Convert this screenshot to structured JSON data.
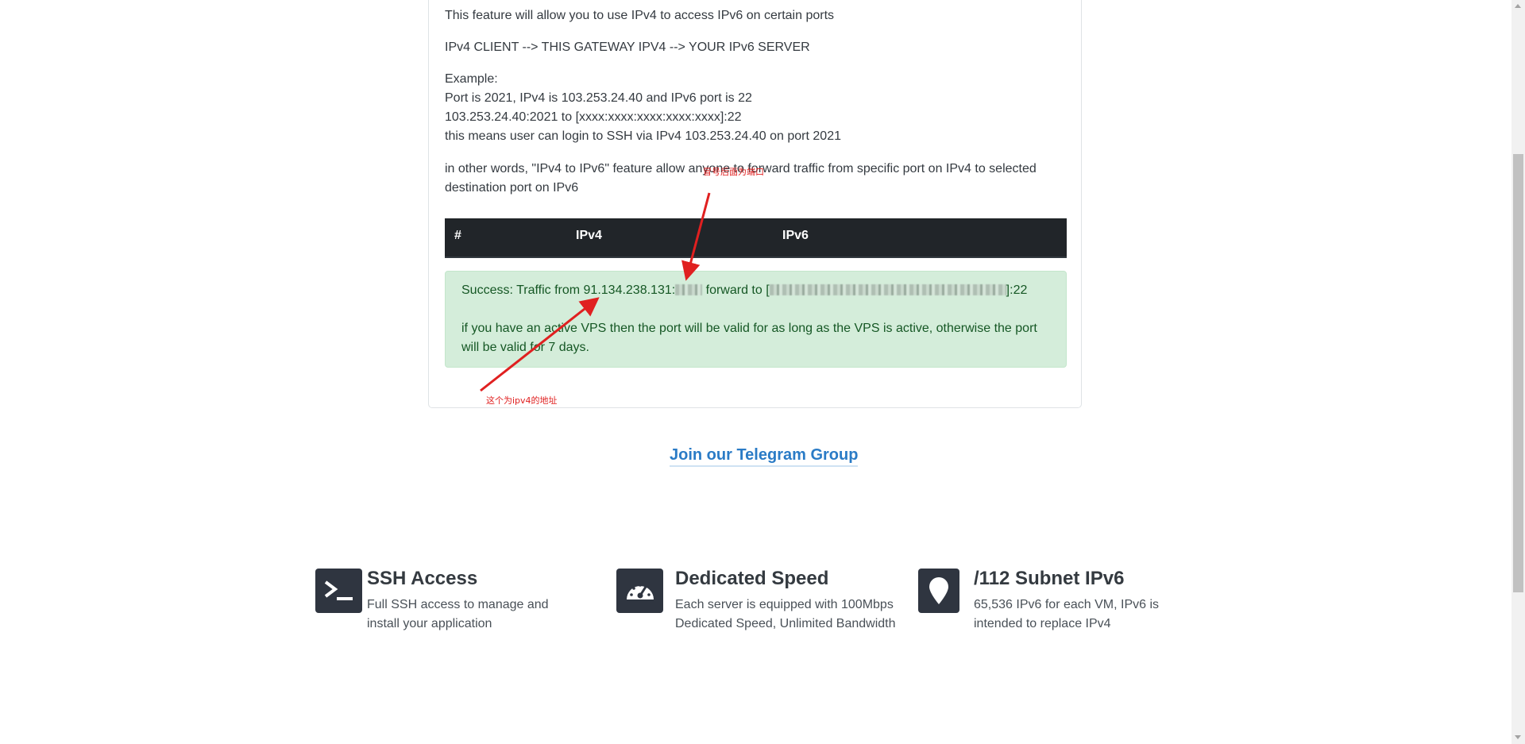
{
  "intro": {
    "line1": "This feature will allow you to use IPv4 to access IPv6 on certain ports",
    "line2": "IPv4 CLIENT --> THIS GATEWAY IPV4 --> YOUR IPv6 SERVER",
    "example_heading": "Example:",
    "example_1": "Port is 2021, IPv4 is 103.253.24.40 and IPv6 port is 22",
    "example_2": "103.253.24.40:2021 to [xxxx:xxxx:xxxx:xxxx:xxxx]:22",
    "example_3": "this means user can login to SSH via IPv4 103.253.24.40 on port 2021",
    "other_words_1": "in other words, \"IPv4 to IPv6\" feature allow anyone to forward traffic from specific port on IPv4 to selected",
    "other_words_2": "destination port on IPv6"
  },
  "table": {
    "col_hash": "#",
    "col_ipv4": "IPv4",
    "col_ipv6": "IPv6"
  },
  "alert": {
    "prefix": "Success: Traffic from 91.134.238.131:",
    "middle": " forward to [",
    "suffix": "]:22",
    "validity": "if you have an active VPS then the port will be valid for as long as the VPS is active, otherwise the port will be valid for 7 days."
  },
  "annotations": {
    "port_note": "冒号后面为端口",
    "ipv4_note": "这个为ipv4的地址",
    "color": "#e02020"
  },
  "telegram": {
    "label": "Join our Telegram Group"
  },
  "features": [
    {
      "icon": "terminal-icon",
      "title": "SSH Access",
      "desc": "Full SSH access to manage and install your application"
    },
    {
      "icon": "speedometer-icon",
      "title": "Dedicated Speed",
      "desc": "Each server is equipped with 100Mbps Dedicated Speed, Unlimited Bandwidth"
    },
    {
      "icon": "map-pin-icon",
      "title": "/112 Subnet IPv6",
      "desc": "65,536 IPv6 for each VM, IPv6 is intended to replace IPv4"
    }
  ],
  "colors": {
    "table_header_bg": "#212529",
    "alert_bg": "#d4edda",
    "alert_text": "#155724",
    "link": "#2a7bc6",
    "icon_bg": "#2f3540"
  }
}
